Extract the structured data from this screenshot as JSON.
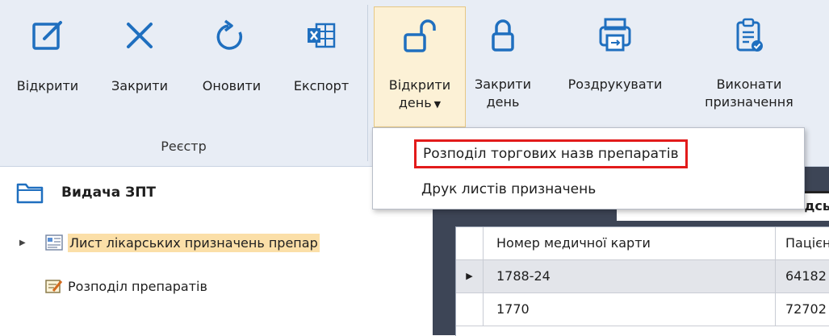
{
  "ribbon": {
    "group_label": "Реєстр",
    "buttons": [
      {
        "name": "open",
        "label": "Відкрити",
        "icon": "edit-square-icon"
      },
      {
        "name": "close",
        "label": "Закрити",
        "icon": "close-x-icon"
      },
      {
        "name": "refresh",
        "label": "Оновити",
        "icon": "refresh-arrow-icon"
      },
      {
        "name": "export",
        "label": "Експорт",
        "icon": "excel-export-icon"
      }
    ],
    "day_buttons": {
      "open_day": {
        "line1": "Відкрити",
        "line2": "день",
        "caret": "▼",
        "icon": "unlocked-padlock-icon"
      },
      "close_day": {
        "line1": "Закрити",
        "line2": "день",
        "icon": "locked-padlock-icon"
      },
      "print": {
        "line1": "Роздрукувати",
        "icon": "printer-icon"
      },
      "execute": {
        "line1": "Виконати",
        "line2": "призначення",
        "icon": "clipboard-check-icon"
      }
    }
  },
  "dropdown": {
    "items": [
      "Розподіл торгових назв препаратів",
      "Друк листів призначень"
    ]
  },
  "sidebar": {
    "title": "Видача ЗПТ",
    "items": [
      {
        "label": "Лист лікарських призначень препар",
        "selected": true,
        "icon": "document-list-icon"
      },
      {
        "label": "Розподіл препаратів",
        "selected": false,
        "icon": "edit-note-icon"
      }
    ]
  },
  "main": {
    "strip_text": "дсь",
    "columns": [
      "Номер медичної карти",
      "Пацієн"
    ],
    "rows": [
      {
        "marker": "▶",
        "card": "1788-24",
        "patient": "64182"
      },
      {
        "marker": "",
        "card": "1770",
        "patient": "72702"
      }
    ]
  },
  "colors": {
    "ribbon_bg": "#e8edf5",
    "icon_blue": "#1f6fbf",
    "highlight_red": "#e21b1b",
    "selected_bg": "#fbdfa8",
    "main_bg": "#3d4556"
  }
}
